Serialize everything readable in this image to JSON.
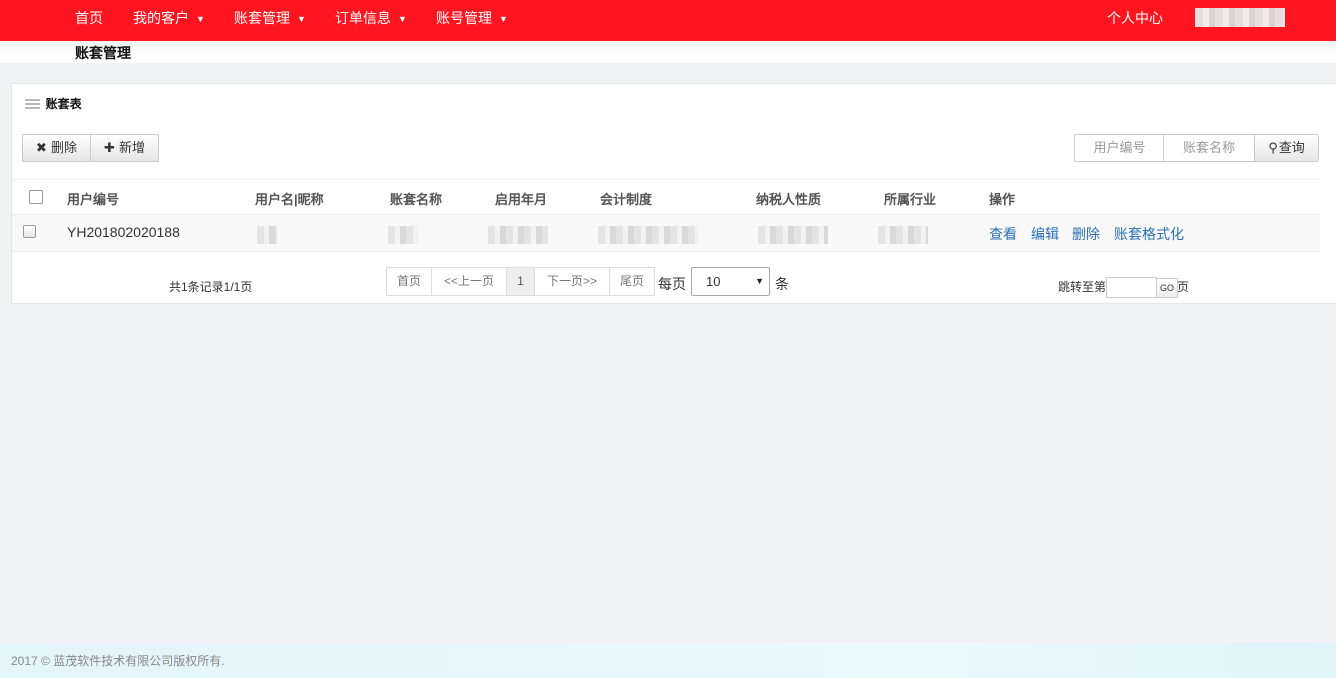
{
  "nav": {
    "items": [
      {
        "label": "首页",
        "dropdown": false
      },
      {
        "label": "我的客户",
        "dropdown": true
      },
      {
        "label": "账套管理",
        "dropdown": true
      },
      {
        "label": "订单信息",
        "dropdown": true
      },
      {
        "label": "账号管理",
        "dropdown": true
      }
    ],
    "caret": "▼",
    "personal_center": "个人中心",
    "bg_color": "#ff151f"
  },
  "breadcrumb": {
    "title": "账套管理"
  },
  "panel": {
    "title": "账套表",
    "delete_label": "删除",
    "add_label": "新增",
    "search_user_no_placeholder": "用户编号",
    "search_account_name_placeholder": "账套名称",
    "query_label": "查询"
  },
  "table": {
    "columns": [
      "用户编号",
      "用户名|昵称",
      "账套名称",
      "启用年月",
      "会计制度",
      "纳税人性质",
      "所属行业",
      "操作"
    ],
    "rows": [
      {
        "user_no": "YH201802020188",
        "actions": [
          "查看",
          "编辑",
          "删除",
          "账套格式化"
        ]
      }
    ]
  },
  "pagination": {
    "summary": "共1条记录1/1页",
    "first": "首页",
    "prev": "<<上一页",
    "current": "1",
    "next": "下一页>>",
    "last": "尾页",
    "per_page_label": "每页",
    "per_page_value": "10",
    "per_page_unit": "条",
    "jump_label": "跳转至第",
    "jump_unit": "页",
    "go_label": "GO"
  },
  "footer": {
    "text": "2017 © 蓝茂软件技术有限公司版权所有."
  },
  "colors": {
    "link": "#2a6fb4",
    "footer_bg": "#e3f6fb"
  }
}
